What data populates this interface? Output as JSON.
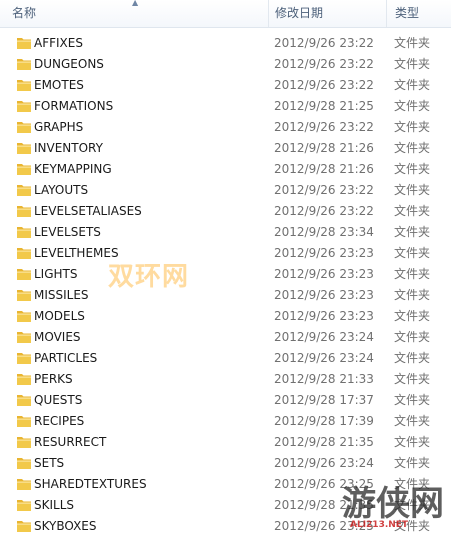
{
  "columns": {
    "name": "名称",
    "date": "修改日期",
    "type": "类型"
  },
  "files": [
    {
      "name": "AFFIXES",
      "date": "2012/9/26 23:22",
      "type": "文件夹"
    },
    {
      "name": "DUNGEONS",
      "date": "2012/9/26 23:22",
      "type": "文件夹"
    },
    {
      "name": "EMOTES",
      "date": "2012/9/26 23:22",
      "type": "文件夹"
    },
    {
      "name": "FORMATIONS",
      "date": "2012/9/28 21:25",
      "type": "文件夹"
    },
    {
      "name": "GRAPHS",
      "date": "2012/9/26 23:22",
      "type": "文件夹"
    },
    {
      "name": "INVENTORY",
      "date": "2012/9/28 21:26",
      "type": "文件夹"
    },
    {
      "name": "KEYMAPPING",
      "date": "2012/9/28 21:26",
      "type": "文件夹"
    },
    {
      "name": "LAYOUTS",
      "date": "2012/9/26 23:22",
      "type": "文件夹"
    },
    {
      "name": "LEVELSETALIASES",
      "date": "2012/9/26 23:22",
      "type": "文件夹"
    },
    {
      "name": "LEVELSETS",
      "date": "2012/9/28 23:34",
      "type": "文件夹"
    },
    {
      "name": "LEVELTHEMES",
      "date": "2012/9/26 23:23",
      "type": "文件夹"
    },
    {
      "name": "LIGHTS",
      "date": "2012/9/26 23:23",
      "type": "文件夹"
    },
    {
      "name": "MISSILES",
      "date": "2012/9/26 23:23",
      "type": "文件夹"
    },
    {
      "name": "MODELS",
      "date": "2012/9/26 23:23",
      "type": "文件夹"
    },
    {
      "name": "MOVIES",
      "date": "2012/9/26 23:24",
      "type": "文件夹"
    },
    {
      "name": "PARTICLES",
      "date": "2012/9/26 23:24",
      "type": "文件夹"
    },
    {
      "name": "PERKS",
      "date": "2012/9/28 21:33",
      "type": "文件夹"
    },
    {
      "name": "QUESTS",
      "date": "2012/9/28 17:37",
      "type": "文件夹"
    },
    {
      "name": "RECIPES",
      "date": "2012/9/28 17:39",
      "type": "文件夹"
    },
    {
      "name": "RESURRECT",
      "date": "2012/9/28 21:35",
      "type": "文件夹"
    },
    {
      "name": "SETS",
      "date": "2012/9/26 23:24",
      "type": "文件夹"
    },
    {
      "name": "SHAREDTEXTURES",
      "date": "2012/9/26 23:25",
      "type": "文件夹"
    },
    {
      "name": "SKILLS",
      "date": "2012/9/28 21:35",
      "type": "文件夹"
    },
    {
      "name": "SKYBOXES",
      "date": "2012/9/26 23:25",
      "type": "文件夹"
    }
  ],
  "watermark": "双环网",
  "logo": {
    "text": "游侠网",
    "url": "ALI213.NET"
  },
  "colors": {
    "folder": "#f2c94a",
    "header_text": "#4c607a",
    "meta_text": "#707070"
  }
}
